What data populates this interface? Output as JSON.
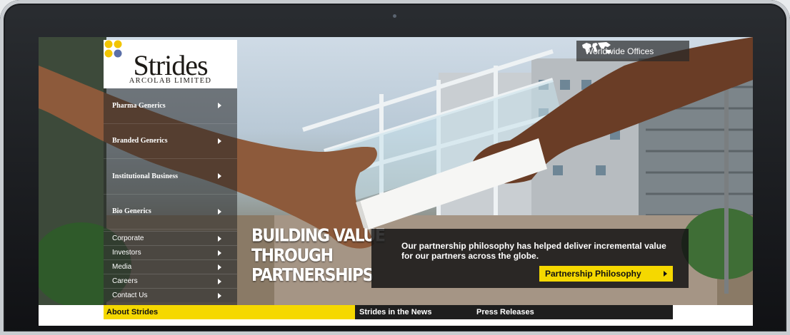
{
  "logo": {
    "name": "Strides",
    "subtitle": "ARCOLAB LIMITED"
  },
  "worldwide": {
    "label": "Worldwide Offices",
    "icon": "world-map-icon"
  },
  "nav": {
    "main": [
      {
        "label": "Pharma Generics"
      },
      {
        "label": "Branded Generics"
      },
      {
        "label": "Institutional Business"
      },
      {
        "label": "Bio Generics"
      }
    ],
    "sub": [
      {
        "label": "Corporate"
      },
      {
        "label": "Investors"
      },
      {
        "label": "Media"
      },
      {
        "label": "Careers"
      },
      {
        "label": "Contact Us"
      }
    ]
  },
  "hero": {
    "tagline": [
      "BUILDING VALUE",
      "THROUGH",
      "PARTNERSHIPS"
    ],
    "info_text": "Our partnership philosophy has helped deliver incremental value for our partners across the globe.",
    "button_label": "Partnership Philosophy"
  },
  "bottom_tabs": {
    "about": "About Strides",
    "news": "Strides in the News",
    "press": "Press Releases"
  },
  "colors": {
    "accent": "#f5d800",
    "dark": "#1e1e1e",
    "logo_dot_yellow": "#f2c500",
    "logo_dot_blue": "#5b6fa8"
  }
}
